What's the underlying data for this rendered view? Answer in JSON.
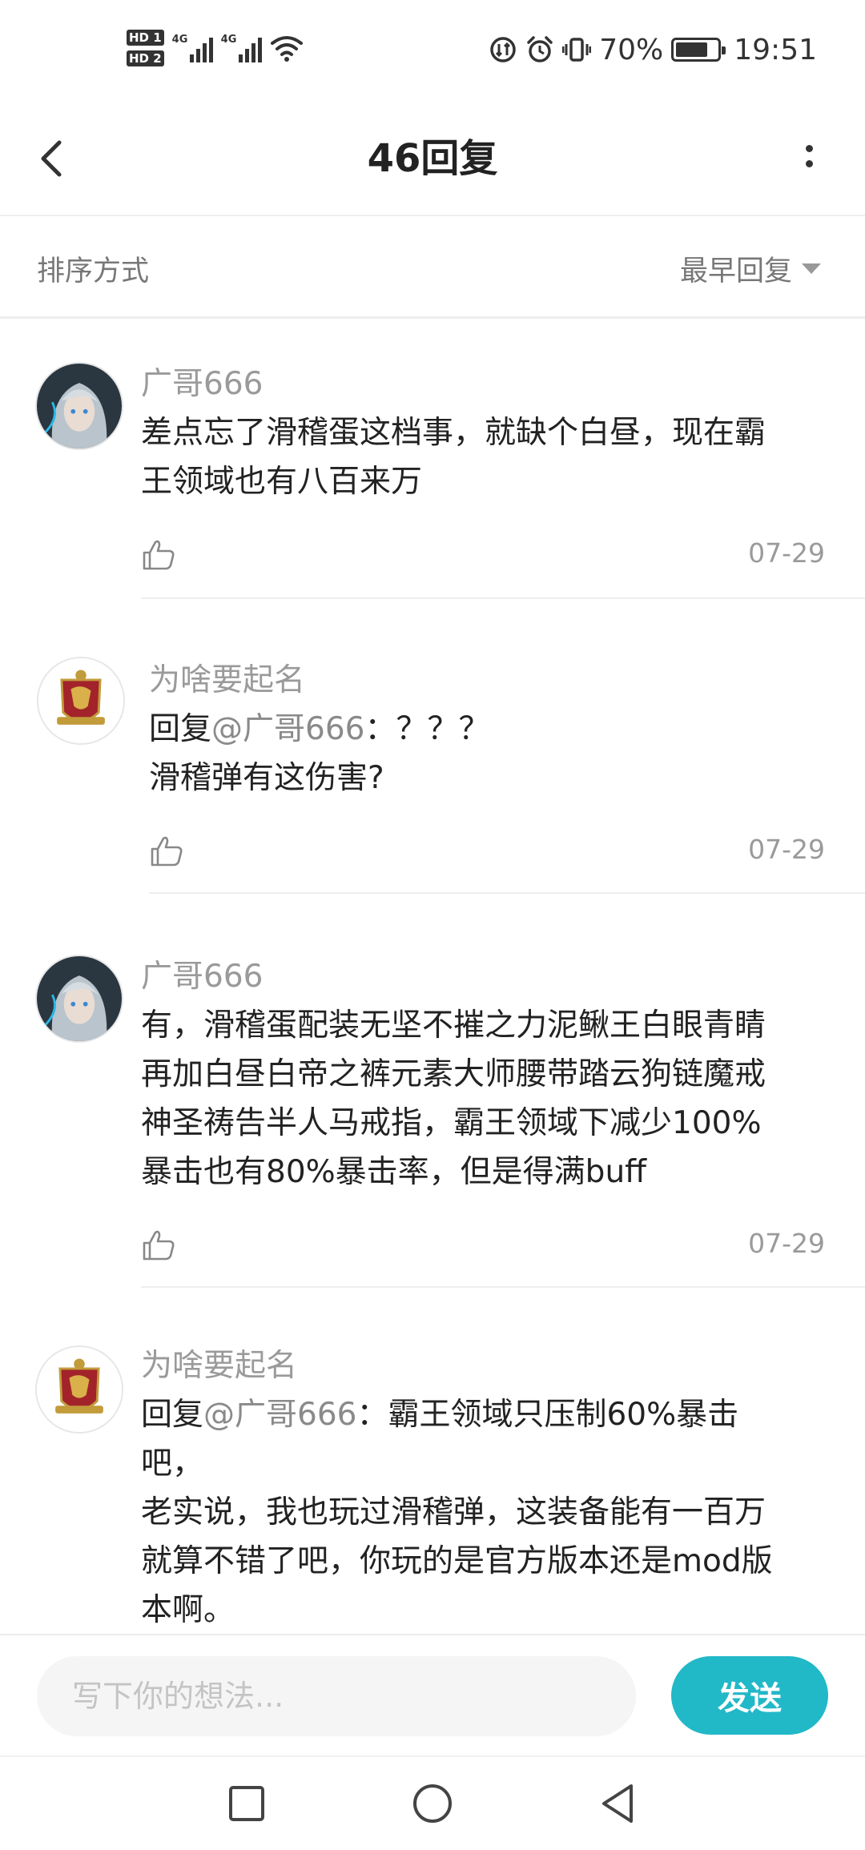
{
  "status_bar": {
    "sim1": "HD 1",
    "sim2": "HD 2",
    "net1": "4G",
    "net2": "4G",
    "battery": "70%",
    "battery_level": 0.7,
    "time": "19:51"
  },
  "header": {
    "title": "46回复"
  },
  "sort": {
    "label": "排序方式",
    "value": "最早回复"
  },
  "comments": [
    {
      "author": "广哥666",
      "text": "差点忘了滑稽蛋这档事，就缺个白昼，现在霸\n王领域也有八百来万",
      "date": "07-29"
    },
    {
      "author": "为啥要起名",
      "reply_prefix": "回复",
      "mention": "@广哥666",
      "text": "：？？？\n滑稽弹有这伤害?",
      "date": "07-29"
    },
    {
      "author": "广哥666",
      "text": "有，滑稽蛋配装无坚不摧之力泥鳅王白眼青睛\n再加白昼白帝之裤元素大师腰带踏云狗链魔戒\n神圣祷告半人马戒指，霸王领域下减少100%\n暴击也有80%暴击率，但是得满buff",
      "date": "07-29"
    },
    {
      "author": "为啥要起名",
      "reply_prefix": "回复",
      "mention": "@广哥666",
      "text": "：霸王领域只压制60%暴击\n吧，\n老实说，我也玩过滑稽弹，这装备能有一百万\n就算不错了吧，你玩的是官方版本还是mod版\n本啊。"
    }
  ],
  "input": {
    "placeholder": "写下你的想法...",
    "send_label": "发送"
  },
  "colors": {
    "accent": "#21b8c8",
    "secondary_text": "#9a9a9a"
  }
}
